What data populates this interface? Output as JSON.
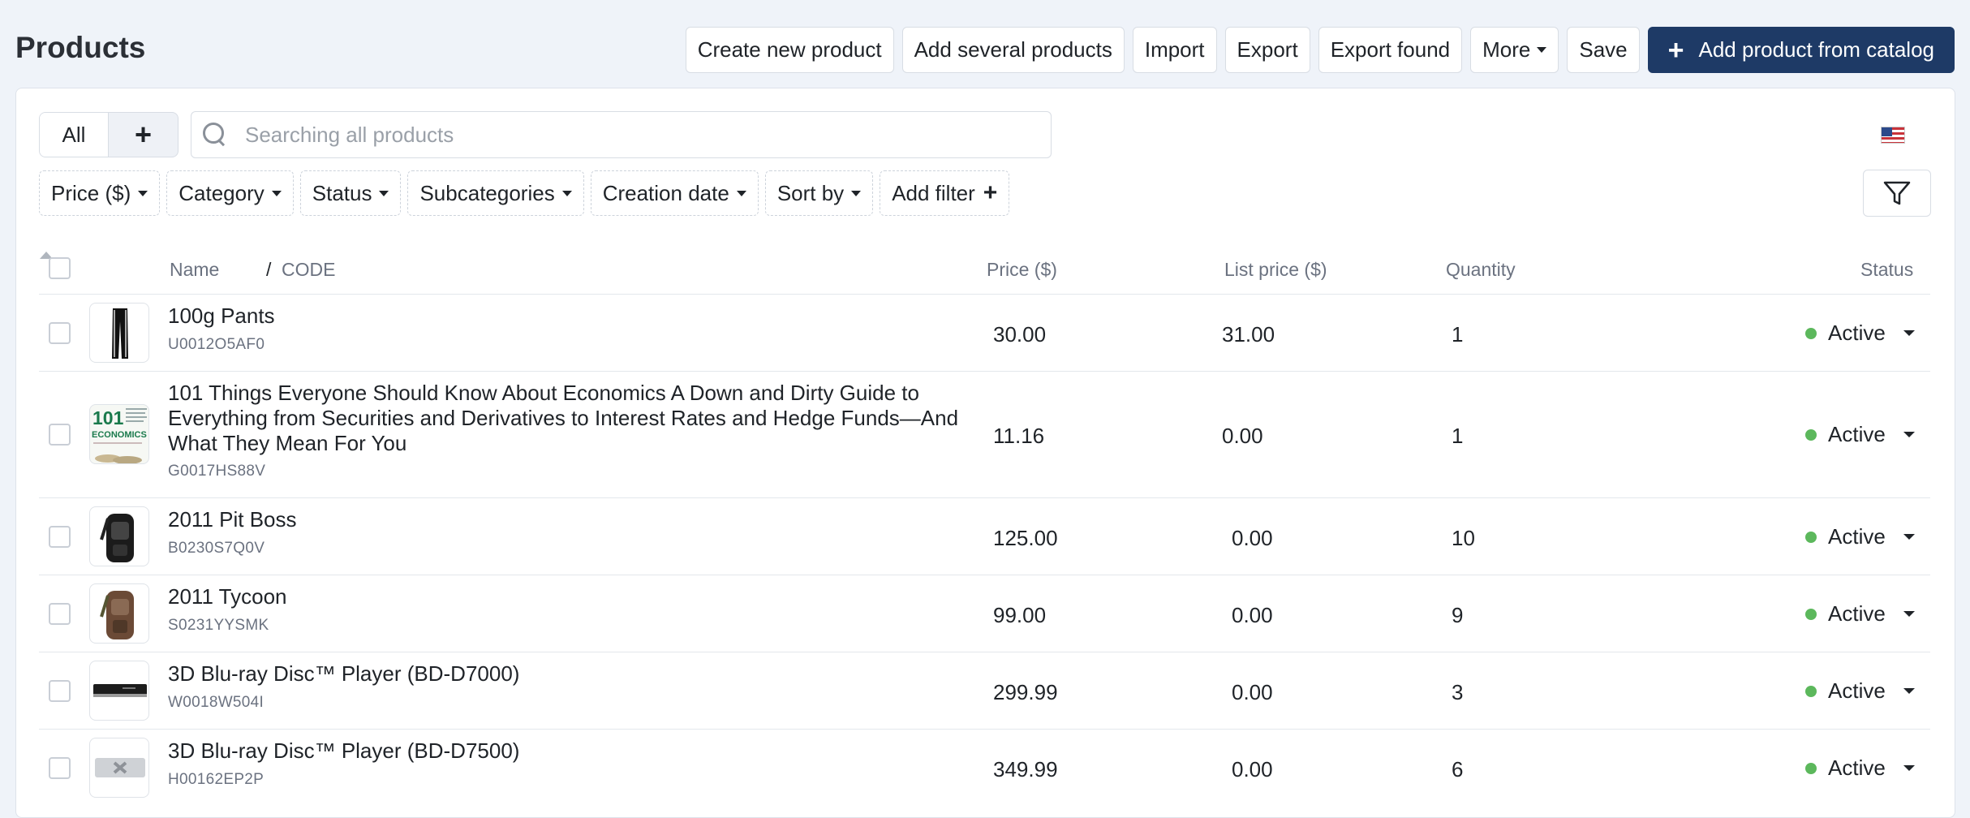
{
  "page": {
    "title": "Products"
  },
  "toolbar": {
    "create_new": "Create new product",
    "add_several": "Add several products",
    "import": "Import",
    "export": "Export",
    "export_found": "Export found",
    "more": "More",
    "save": "Save",
    "add_from_catalog": "Add product from catalog"
  },
  "tabs": {
    "all": "All",
    "add": "+"
  },
  "search": {
    "placeholder": "Searching all products",
    "value": ""
  },
  "filters": [
    {
      "label": "Price ($)"
    },
    {
      "label": "Category"
    },
    {
      "label": "Status"
    },
    {
      "label": "Subcategories"
    },
    {
      "label": "Creation date"
    },
    {
      "label": "Sort by"
    },
    {
      "label": "Add filter"
    }
  ],
  "table": {
    "headers": {
      "name": "Name",
      "separator": "/",
      "code": "CODE",
      "price": "Price ($)",
      "list_price": "List price ($)",
      "quantity": "Quantity",
      "status": "Status"
    },
    "rows": [
      {
        "name": "100g Pants",
        "code": "U0012O5AF0",
        "price": "30.00",
        "list_price": "31.00",
        "quantity": "1",
        "status": "Active"
      },
      {
        "name": "101 Things Everyone Should Know About Economics A Down and Dirty Guide to Everything from Securities and Derivatives to Interest Rates and Hedge Funds—And What They Mean For You",
        "code": "G0017HS88V",
        "price": "11.16",
        "list_price": "0.00",
        "quantity": "1",
        "status": "Active",
        "thumb_text_1": "101",
        "thumb_text_2": "ECONOMICS"
      },
      {
        "name": "2011 Pit Boss",
        "code": "B0230S7Q0V",
        "price": "125.00",
        "list_price": "0.00",
        "quantity": "10",
        "status": "Active"
      },
      {
        "name": "2011 Tycoon",
        "code": "S0231YYSMK",
        "price": "99.00",
        "list_price": "0.00",
        "quantity": "9",
        "status": "Active"
      },
      {
        "name": "3D Blu-ray Disc™ Player (BD-D7000)",
        "code": "W0018W504I",
        "price": "299.99",
        "list_price": "0.00",
        "quantity": "3",
        "status": "Active"
      },
      {
        "name": "3D Blu-ray Disc™ Player (BD-D7500)",
        "code": "H00162EP2P",
        "price": "349.99",
        "list_price": "0.00",
        "quantity": "6",
        "status": "Active"
      }
    ]
  },
  "colors": {
    "primary": "#1e3a66",
    "active": "#5cb85c",
    "background": "#eff3f9"
  },
  "icons": {
    "search": "search-icon",
    "filter": "funnel-icon",
    "flag": "us-flag-icon",
    "sort": "sort-asc-icon"
  }
}
